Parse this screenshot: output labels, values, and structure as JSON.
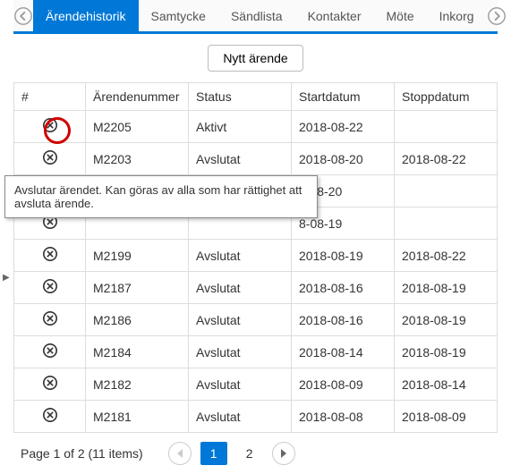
{
  "tabs": {
    "items": [
      {
        "label": "Ärendehistorik",
        "active": true
      },
      {
        "label": "Samtycke",
        "active": false
      },
      {
        "label": "Sändlista",
        "active": false
      },
      {
        "label": "Kontakter",
        "active": false
      },
      {
        "label": "Möte",
        "active": false
      },
      {
        "label": "Inkorg",
        "active": false
      }
    ]
  },
  "new_button_label": "Nytt ärende",
  "table": {
    "headers": {
      "hash": "#",
      "num": "Ärendenummer",
      "status": "Status",
      "start": "Startdatum",
      "stop": "Stoppdatum"
    },
    "rows": [
      {
        "num": "M2205",
        "status": "Aktivt",
        "start": "2018-08-22",
        "stop": ""
      },
      {
        "num": "M2203",
        "status": "Avslutat",
        "start": "2018-08-20",
        "stop": "2018-08-22"
      },
      {
        "num": "",
        "status": "",
        "start": "8-08-20",
        "stop": ""
      },
      {
        "num": "",
        "status": "",
        "start": "8-08-19",
        "stop": ""
      },
      {
        "num": "M2199",
        "status": "Avslutat",
        "start": "2018-08-19",
        "stop": "2018-08-22"
      },
      {
        "num": "M2187",
        "status": "Avslutat",
        "start": "2018-08-16",
        "stop": "2018-08-19"
      },
      {
        "num": "M2186",
        "status": "Avslutat",
        "start": "2018-08-16",
        "stop": "2018-08-19"
      },
      {
        "num": "M2184",
        "status": "Avslutat",
        "start": "2018-08-14",
        "stop": "2018-08-19"
      },
      {
        "num": "M2182",
        "status": "Avslutat",
        "start": "2018-08-09",
        "stop": "2018-08-14"
      },
      {
        "num": "M2181",
        "status": "Avslutat",
        "start": "2018-08-08",
        "stop": "2018-08-09"
      }
    ]
  },
  "tooltip_text": "Avslutar ärendet. Kan göras av alla som har rättighet att avsluta ärende.",
  "pager": {
    "summary": "Page 1 of 2 (11 items)",
    "pages": [
      "1",
      "2"
    ],
    "active": "1"
  },
  "icons": {
    "close": "close-circle-icon",
    "prev": "arrow-left-icon",
    "next": "arrow-right-icon",
    "pgprev": "triangle-left-icon",
    "pgnext": "triangle-right-icon"
  }
}
